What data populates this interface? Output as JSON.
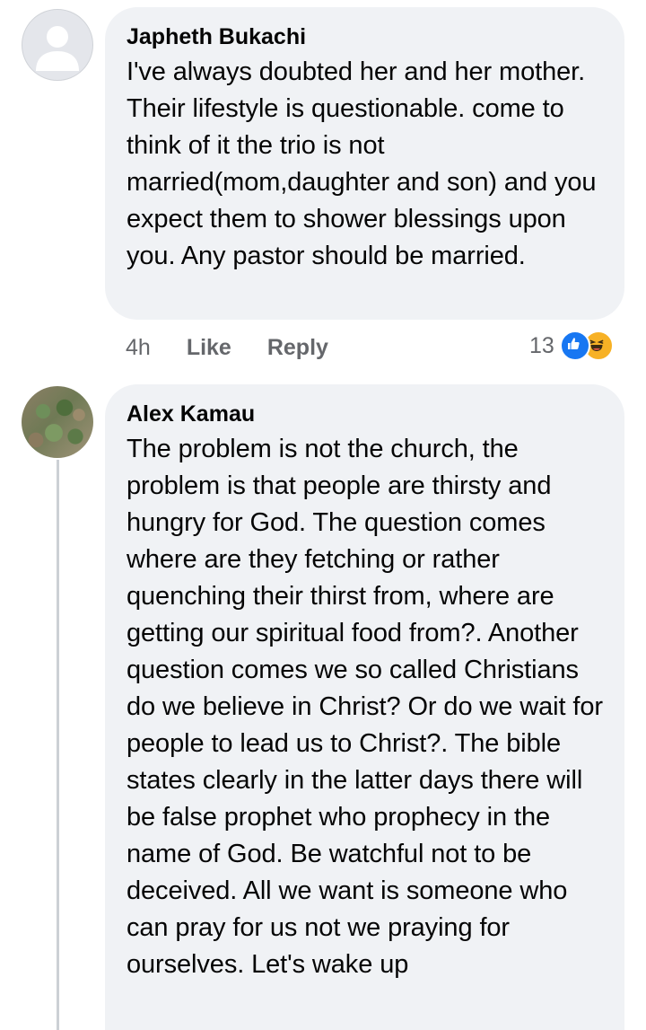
{
  "comments": [
    {
      "author": "Japheth Bukachi",
      "text": "I've always doubted her and her mother. Their lifestyle is questionable. come to think of it the trio is not married(mom,daughter and son) and you expect them to shower blessings upon you. Any  pastor should be married.",
      "time": "4h",
      "like_label": "Like",
      "reply_label": "Reply",
      "reaction_count": "13",
      "reactions": [
        "like-reaction-icon",
        "haha-reaction-icon"
      ]
    },
    {
      "author": "Alex Kamau",
      "text": "The problem is not the church, the problem is that people are thirsty and hungry for God. The question comes where are they fetching or rather quenching their thirst from, where are getting our spiritual food from?. Another question comes we so called Christians do we believe in Christ? Or do we wait for people to lead us to Christ?. The bible states clearly in the latter days there will be false prophet who prophecy in the name of God. Be watchful not to be deceived. All we want is someone who can pray for us not we praying for ourselves. Let's wake up"
    }
  ],
  "colors": {
    "bubble": "#f0f2f5",
    "meta_text": "#65676b",
    "like_blue": "#1877f2",
    "haha_yellow": "#f7b125"
  }
}
